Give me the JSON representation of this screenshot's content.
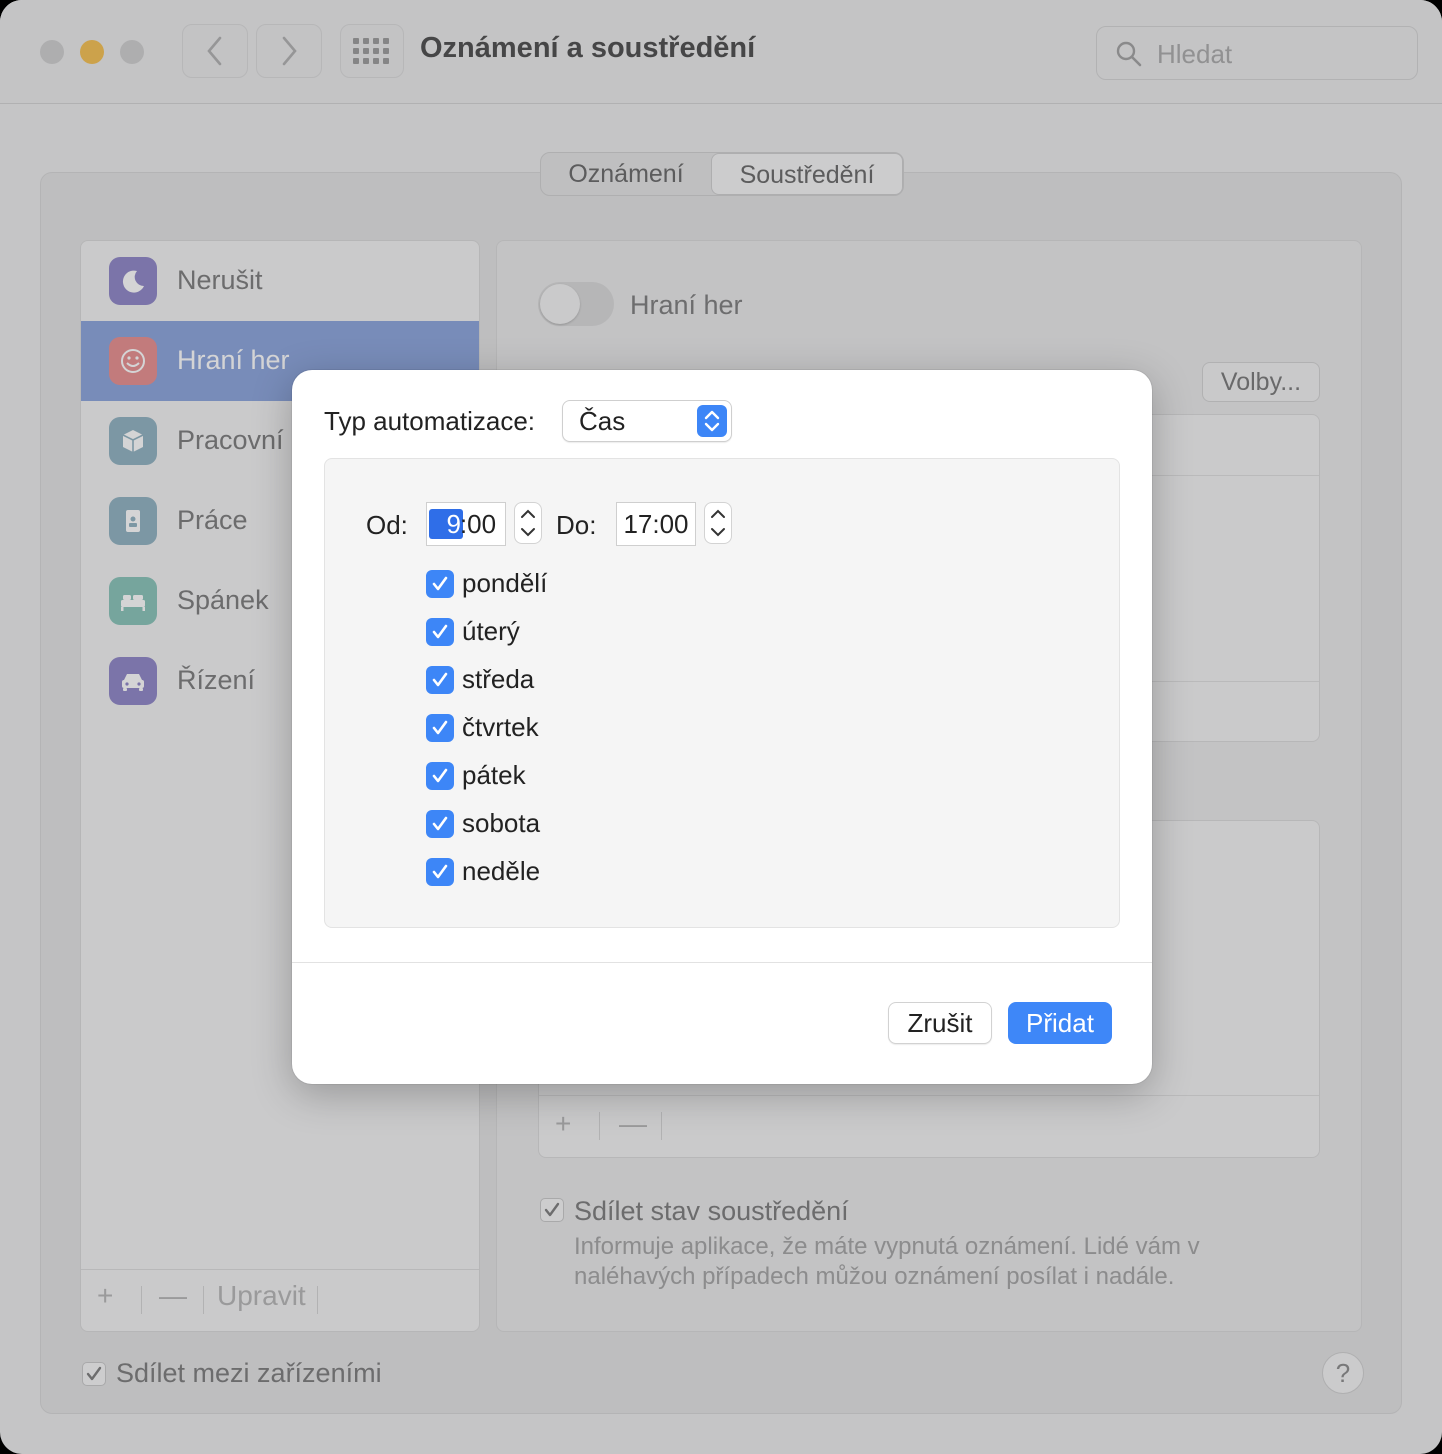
{
  "window": {
    "title": "Oznámení a soustředění",
    "search_placeholder": "Hledat",
    "tabs": [
      {
        "label": "Oznámení",
        "selected": false
      },
      {
        "label": "Soustředění",
        "selected": true
      }
    ]
  },
  "sidebar": {
    "items": [
      {
        "label": "Nerušit",
        "icon": "moon-icon",
        "color": "#8e85c7",
        "selected": false
      },
      {
        "label": "Hraní her",
        "icon": "smiley-icon",
        "color": "#e88d8d",
        "selected": true
      },
      {
        "label": "Pracovní",
        "icon": "box-icon",
        "color": "#8fb1c0",
        "selected": false
      },
      {
        "label": "Práce",
        "icon": "badge-icon",
        "color": "#8fb1c0",
        "selected": false
      },
      {
        "label": "Spánek",
        "icon": "bed-icon",
        "color": "#87c3b8",
        "selected": false
      },
      {
        "label": "Řízení",
        "icon": "car-icon",
        "color": "#8e85c7",
        "selected": false
      }
    ],
    "footer": {
      "add": "+",
      "remove": "—",
      "edit": "Upravit"
    }
  },
  "detail": {
    "toggle_label": "Hraní her",
    "options_button": "Volby...",
    "list_footer": {
      "add": "+",
      "remove": "—"
    },
    "share_status_label": "Sdílet stav soustředění",
    "share_status_desc": "Informuje aplikace, že máte vypnutá oznámení. Lidé vám v naléhavých případech můžou oznámení posílat i nadále."
  },
  "share_devices_label": "Sdílet mezi zařízeními",
  "help": "?",
  "sheet": {
    "type_label": "Typ automatizace:",
    "type_value": "Čas",
    "from_label": "Od:",
    "from_hour": "9",
    "from_rest": ":00",
    "to_label": "Do:",
    "to_value": "17:00",
    "days": [
      {
        "label": "pondělí",
        "checked": true
      },
      {
        "label": "úterý",
        "checked": true
      },
      {
        "label": "středa",
        "checked": true
      },
      {
        "label": "čtvrtek",
        "checked": true
      },
      {
        "label": "pátek",
        "checked": true
      },
      {
        "label": "sobota",
        "checked": true
      },
      {
        "label": "neděle",
        "checked": true
      }
    ],
    "cancel": "Zrušit",
    "add": "Přidat"
  },
  "colors": {
    "accent": "#3e87f8",
    "selection": "#8aa3dc"
  }
}
